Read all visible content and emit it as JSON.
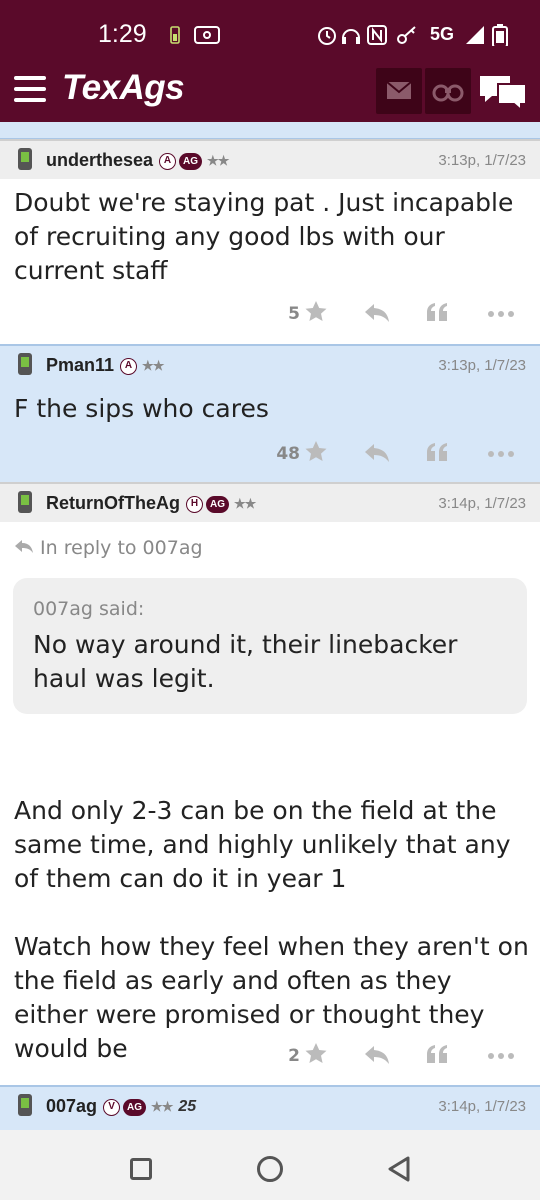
{
  "status_bar": {
    "time": "1:29",
    "network": "5G"
  },
  "header": {
    "logo": "TexAgs",
    "icons": [
      "menu-icon",
      "mail-icon",
      "binoculars-icon",
      "chat-icon"
    ]
  },
  "posts": [
    {
      "username": "underthesea",
      "badge_letter": "A",
      "badge_ag": "AG",
      "stars": "★★",
      "time": "3:13p, 1/7/23",
      "text": "Doubt we're staying pat . Just incapable of recruiting any good lbs with our current staff",
      "likes": "5"
    },
    {
      "username": "Pman11",
      "badge_letter": "A",
      "stars": "★★",
      "time": "3:13p, 1/7/23",
      "text": "F the sips who cares",
      "likes": "48"
    },
    {
      "username": "ReturnOfTheAg",
      "badge_letter": "H",
      "badge_ag": "AG",
      "stars": "★★",
      "time": "3:14p, 1/7/23",
      "in_reply": "In reply to 007ag",
      "quote_said": "007ag said:",
      "quote_text": "No way around it, their linebacker haul was legit.",
      "text_p1": "And only 2-3 can be on the field at the same time, and highly unlikely that any of them can do it in year 1",
      "text_p2": "Watch how they feel when they aren't on the field as early and often as they either were promised or thought they would be",
      "likes": "2"
    },
    {
      "username": "007ag",
      "badge_letter": "V",
      "badge_ag": "AG",
      "stars": "★★",
      "emblem": "25",
      "time": "3:14p, 1/7/23"
    }
  ],
  "colors": {
    "maroon": "#5a0a2a",
    "post_blue": "#d7e7f8",
    "post_gray": "#eeeeee"
  }
}
